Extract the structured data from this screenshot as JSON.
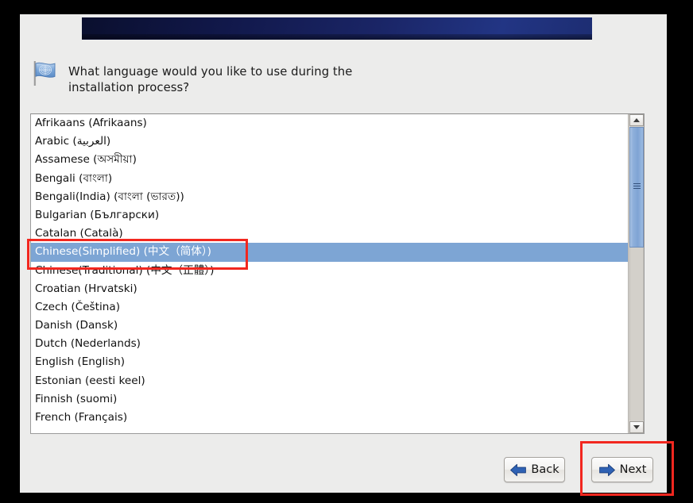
{
  "window": {
    "banner_label": "installer-banner"
  },
  "header": {
    "icon": "flag-icon",
    "question_line1": "What language would you like to use during the",
    "question_line2": "installation process?"
  },
  "language_list": {
    "selected_index": 7,
    "items": [
      {
        "label": "Afrikaans (Afrikaans)"
      },
      {
        "label": "Arabic (العربية)"
      },
      {
        "label": "Assamese (অসমীয়া)"
      },
      {
        "label": "Bengali (বাংলা)"
      },
      {
        "label": "Bengali(India) (বাংলা (ভারত))"
      },
      {
        "label": "Bulgarian (Български)"
      },
      {
        "label": "Catalan (Català)"
      },
      {
        "label": "Chinese(Simplified) (中文（简体）)"
      },
      {
        "label": "Chinese(Traditional) (中文（正體）)"
      },
      {
        "label": "Croatian (Hrvatski)"
      },
      {
        "label": "Czech (Čeština)"
      },
      {
        "label": "Danish (Dansk)"
      },
      {
        "label": "Dutch (Nederlands)"
      },
      {
        "label": "English (English)"
      },
      {
        "label": "Estonian (eesti keel)"
      },
      {
        "label": "Finnish (suomi)"
      },
      {
        "label": "French (Français)"
      }
    ]
  },
  "scrollbar": {
    "up_icon": "chevron-up-icon",
    "down_icon": "chevron-down-icon",
    "thumb": "scrollbar-thumb"
  },
  "footer": {
    "back_label": "Back",
    "back_icon": "arrow-left-icon",
    "next_label": "Next",
    "next_icon": "arrow-right-icon"
  },
  "annotations": [
    {
      "name": "annot-selected-row",
      "color": "#f2271f"
    },
    {
      "name": "annot-next-button",
      "color": "#f2271f"
    }
  ],
  "colors": {
    "panel_bg": "#ececeb",
    "banner_dark": "#0a0f2e",
    "banner_blue": "#223584",
    "selection_blue": "#7da5d4",
    "annotation_red": "#f2271f",
    "arrow_blue": "#2f62b4"
  }
}
